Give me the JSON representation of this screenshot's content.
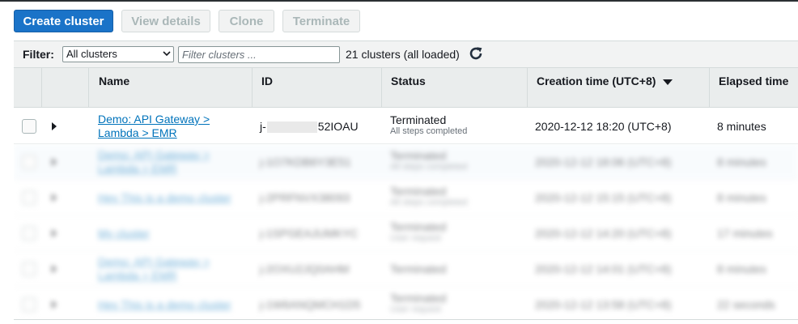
{
  "toolbar": {
    "create_label": "Create cluster",
    "view_details_label": "View details",
    "clone_label": "Clone",
    "terminate_label": "Terminate"
  },
  "filter": {
    "label": "Filter:",
    "selected": "All clusters",
    "placeholder": "Filter clusters ...",
    "count_text": "21 clusters (all loaded)"
  },
  "table": {
    "columns": [
      "Name",
      "ID",
      "Status",
      "Creation time (UTC+8)",
      "Elapsed time"
    ],
    "rows": [
      {
        "name_line1": "Demo: API Gateway >",
        "name_line2": "Lambda > EMR",
        "id_prefix": "j-",
        "id_suffix": "52IOAU",
        "status": "Terminated",
        "status_detail": "All steps completed",
        "created": "2020-12-12 18:20 (UTC+8)",
        "elapsed": "8 minutes"
      },
      {
        "name_line1": "Demo: API Gateway >",
        "name_line2": "Lambda > EMR",
        "id": "j-1O7KDB6Y3E51",
        "status": "Terminated",
        "status_detail": "All steps completed",
        "created": "2020-12-12 18:06 (UTC+8)",
        "elapsed": "8 minutes"
      },
      {
        "name_line1": "Hey This is a demo cluster",
        "name_line2": "",
        "id": "j-2PRFNVX38093",
        "status": "Terminated",
        "status_detail": "All steps completed",
        "created": "2020-12-12 15:15 (UTC+8)",
        "elapsed": "8 minutes"
      },
      {
        "name_line1": "My cluster",
        "name_line2": "",
        "id": "j-1SPGEAJUMKYC",
        "status": "Terminated",
        "status_detail": "User request",
        "created": "2020-12-12 14:20 (UTC+8)",
        "elapsed": "17 minutes"
      },
      {
        "name_line1": "Demo: API Gateway >",
        "name_line2": "Lambda > EMR",
        "id": "j-2OXU2JQ0AHM",
        "status": "Terminated",
        "status_detail": "",
        "created": "2020-12-12 14:01 (UTC+8)",
        "elapsed": "8 minutes"
      },
      {
        "name_line1": "Hey This is a demo cluster",
        "name_line2": "",
        "id": "j-1W6ANQMCH1D5",
        "status": "Terminated",
        "status_detail": "User request",
        "created": "2020-12-12 13:58 (UTC+8)",
        "elapsed": "22 seconds"
      }
    ]
  },
  "colors": {
    "primary": "#1a73c8",
    "link": "#0073bb",
    "header_bg": "#eaeded"
  },
  "icons": {
    "refresh": "refresh-icon",
    "sort": "sort-descending-icon",
    "expand": "expand-caret-icon"
  }
}
